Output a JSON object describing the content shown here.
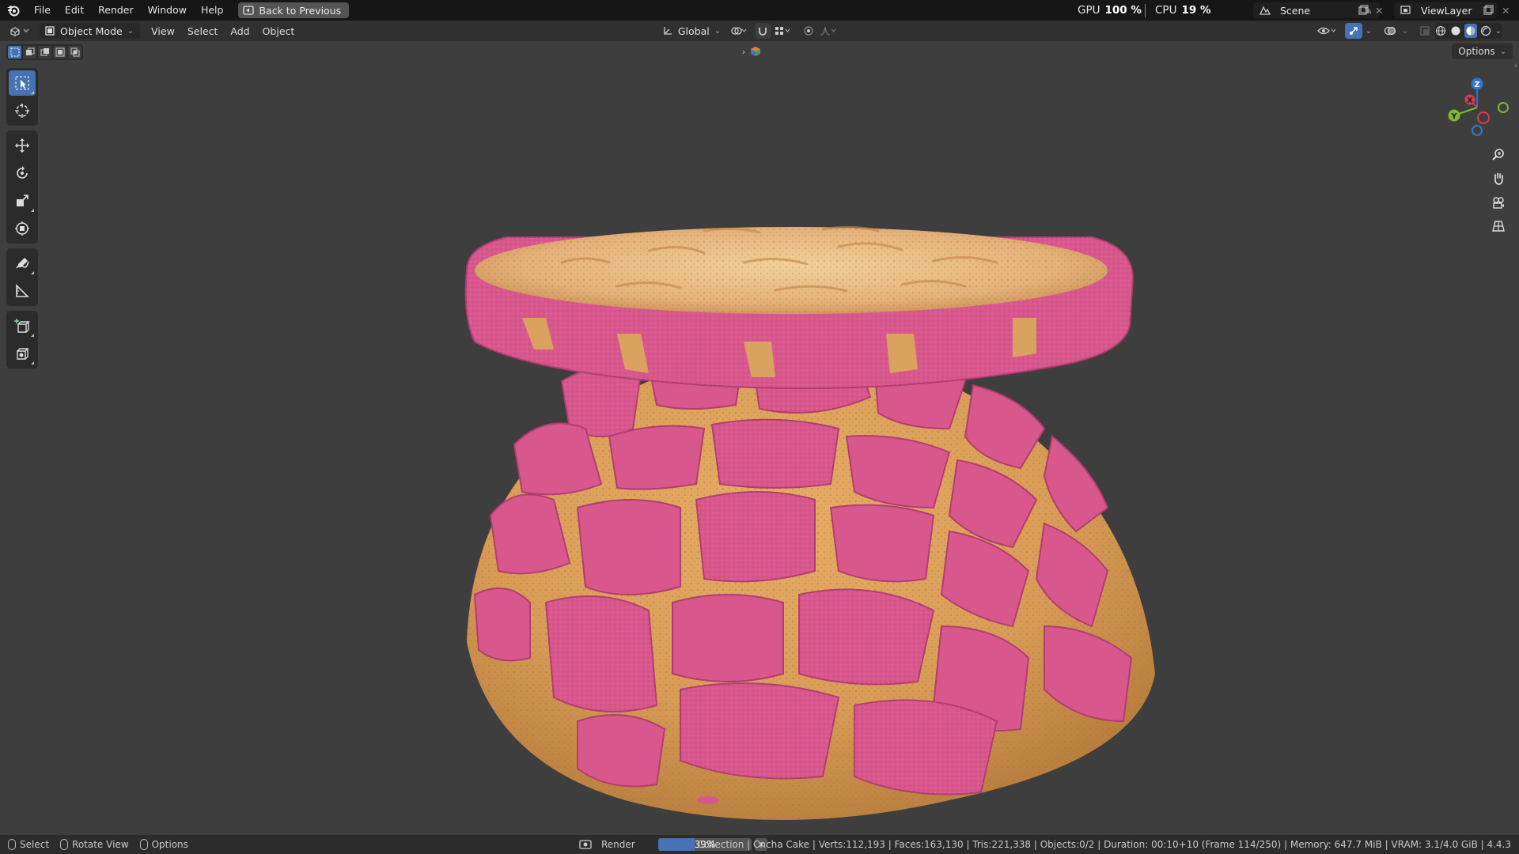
{
  "menubar": {
    "items": [
      "File",
      "Edit",
      "Render",
      "Window",
      "Help"
    ],
    "back_button": "Back to Previous"
  },
  "performance": {
    "gpu_label": "GPU",
    "gpu_value": "100 %",
    "cpu_label": "CPU",
    "cpu_value": "19 %"
  },
  "scene": {
    "name": "Scene"
  },
  "view_layer": {
    "name": "ViewLayer"
  },
  "header": {
    "mode": "Object Mode",
    "menus": [
      "View",
      "Select",
      "Add",
      "Object"
    ],
    "transform_orientation": "Global"
  },
  "viewport": {
    "options_label": "Options",
    "gizmo_axes": {
      "z": "Z",
      "y": "Y",
      "x": "X"
    }
  },
  "statusbar": {
    "hints": [
      "Select",
      "Rotate View",
      "Options"
    ],
    "job_label": "Render",
    "progress_percent": 39,
    "progress_text": "39%",
    "stats": "Collection | Cncha Cake | Verts:112,193 | Faces:163,130 | Tris:221,338 | Objects:0/2 | Duration: 00:10+10 (Frame 114/250) | Memory: 647.7 MiB | VRAM: 3.1/4.0 GiB | 4.4.3"
  },
  "colors": {
    "accent": "#4772b3",
    "topping_pink": "#d8588e",
    "bread_tan": "#d9a25e"
  }
}
